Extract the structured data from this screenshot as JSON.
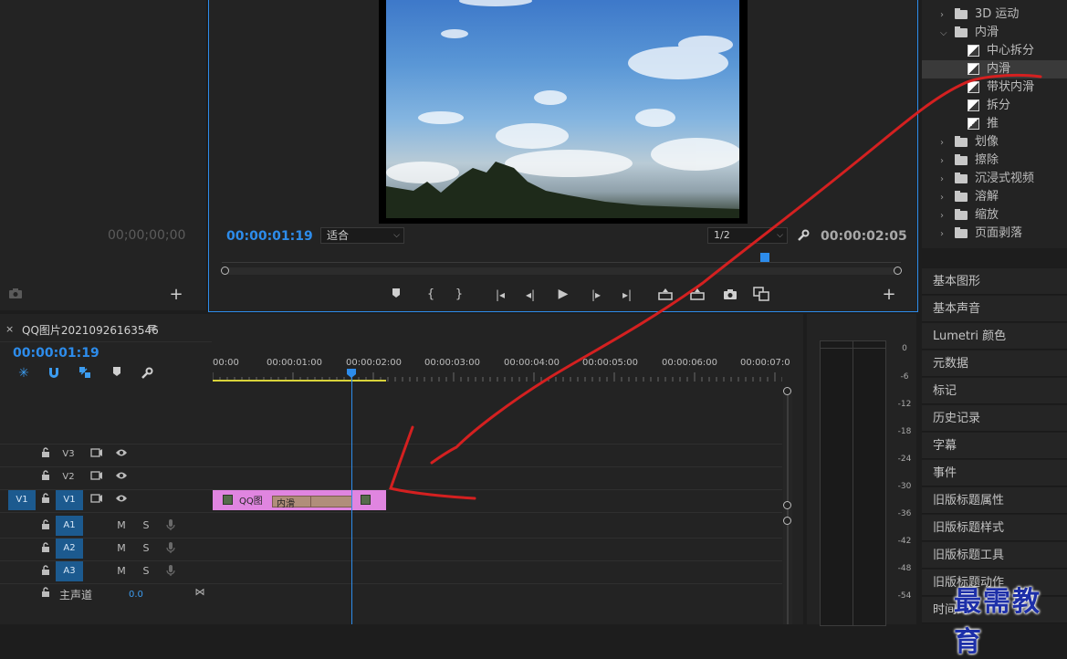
{
  "source_monitor": {
    "timecode": "00;00;00;00"
  },
  "program_monitor": {
    "timecode_current": "00:00:01:19",
    "fit_select": "适合",
    "resolution_select": "1/2",
    "timecode_duration": "00:00:02:05"
  },
  "effects_tree": {
    "rows": [
      {
        "label": "3D 运动",
        "type": "folder",
        "expanded": false
      },
      {
        "label": "内滑",
        "type": "folder",
        "expanded": true
      },
      {
        "label": "中心拆分",
        "type": "transition"
      },
      {
        "label": "内滑",
        "type": "transition",
        "selected": true
      },
      {
        "label": "带状内滑",
        "type": "transition"
      },
      {
        "label": "拆分",
        "type": "transition"
      },
      {
        "label": "推",
        "type": "transition"
      },
      {
        "label": "划像",
        "type": "folder",
        "expanded": false
      },
      {
        "label": "擦除",
        "type": "folder",
        "expanded": false
      },
      {
        "label": "沉浸式视频",
        "type": "folder",
        "expanded": false
      },
      {
        "label": "溶解",
        "type": "folder",
        "expanded": false
      },
      {
        "label": "缩放",
        "type": "folder",
        "expanded": false
      },
      {
        "label": "页面剥落",
        "type": "folder",
        "expanded": false
      }
    ]
  },
  "side_panels": [
    "基本图形",
    "基本声音",
    "Lumetri 颜色",
    "元数据",
    "标记",
    "历史记录",
    "字幕",
    "事件",
    "旧版标题属性",
    "旧版标题样式",
    "旧版标题工具",
    "旧版标题动作",
    "时间码"
  ],
  "timeline": {
    "close_glyph": "×",
    "sequence_name": "QQ图片20210926163546",
    "menu_glyph": "≡",
    "timecode": "00:00:01:19",
    "ruler": [
      "00:00",
      "00:00:01:00",
      "00:00:02:00",
      "00:00:03:00",
      "00:00:04:00",
      "00:00:05:00",
      "00:00:06:00",
      "00:00:07:0"
    ],
    "video_tracks": [
      {
        "name": "V3",
        "source": ""
      },
      {
        "name": "V2",
        "source": ""
      },
      {
        "name": "V1",
        "source": "V1"
      }
    ],
    "audio_tracks": [
      {
        "name": "A1",
        "m": "M",
        "s": "S"
      },
      {
        "name": "A2",
        "m": "M",
        "s": "S"
      },
      {
        "name": "A3",
        "m": "M",
        "s": "S"
      }
    ],
    "master": {
      "label": "主声道",
      "value": "0.0"
    },
    "clip": {
      "label": "QQ图",
      "transition": "内滑",
      "color": "#e085e0"
    }
  },
  "audio_meter": {
    "scale": [
      "0",
      "-6",
      "-12",
      "-18",
      "-24",
      "-30",
      "-36",
      "-42",
      "-48",
      "-54"
    ]
  },
  "watermark": "最需教育",
  "annotation_color": "#d42020"
}
